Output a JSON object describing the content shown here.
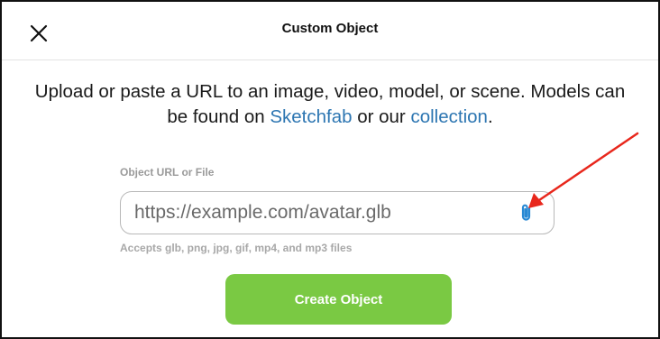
{
  "dialog": {
    "title": "Custom Object",
    "close_icon": "close-icon"
  },
  "description": {
    "text_before": "Upload or paste a URL to an image, video, model, or scene. Models can be found on ",
    "link_sketchfab": "Sketchfab",
    "text_middle": " or our ",
    "link_collection": "collection",
    "text_after": "."
  },
  "url_field": {
    "label": "Object URL or File",
    "placeholder": "https://example.com/avatar.glb",
    "attach_icon": "paperclip-icon",
    "helper": "Accepts glb, png, jpg, gif, mp4, and mp3 files"
  },
  "actions": {
    "create_label": "Create Object"
  },
  "colors": {
    "accent_green": "#7ac943",
    "link_blue": "#2d76b2",
    "attach_blue": "#2a8ad4",
    "annotation_red": "#e8271c"
  }
}
